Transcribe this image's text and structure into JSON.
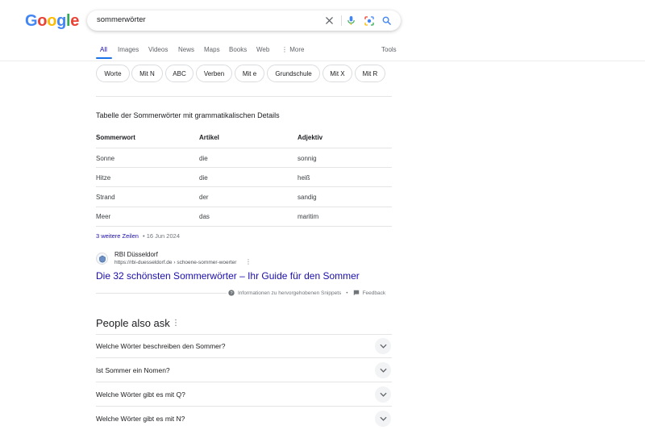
{
  "search": {
    "logo_text": "Google",
    "query": "sommerwörter"
  },
  "tabs": {
    "items": [
      "All",
      "Images",
      "Videos",
      "News",
      "Maps",
      "Books",
      "Web",
      "More"
    ],
    "tools": "Tools"
  },
  "chips": [
    "Worte",
    "Mit N",
    "ABC",
    "Verben",
    "Mit e",
    "Grundschule",
    "Mit X",
    "Mit R"
  ],
  "featured_snippet": {
    "caption": "Tabelle der Sommerwörter mit grammatikalischen Details",
    "columns": [
      "Sommerwort",
      "Artikel",
      "Adjektiv"
    ],
    "rows": [
      [
        "Sonne",
        "die",
        "sonnig"
      ],
      [
        "Hitze",
        "die",
        "heiß"
      ],
      [
        "Strand",
        "der",
        "sandig"
      ],
      [
        "Meer",
        "das",
        "maritim"
      ]
    ],
    "more_rows": "3 weitere Zeilen",
    "date": "• 16 Jun 2024",
    "site_name": "RBI Düsseldorf",
    "site_url": "https://rbi-duesseldorf.de › schoene-sommer-woerter",
    "result_title": "Die 32 schönsten Sommerwörter – Ihr Guide für den Sommer",
    "info_label": "Informationen zu hervorgehobenen Snippets",
    "feedback_label": "Feedback"
  },
  "people_also_ask": {
    "title": "People also ask",
    "questions": [
      "Welche Wörter beschreiben den Sommer?",
      "Ist Sommer ein Nomen?",
      "Welche Wörter gibt es mit Q?",
      "Welche Wörter gibt es mit N?"
    ]
  },
  "colors": {
    "link": "#1a0dab",
    "active_tab_underline": "#1a73e8",
    "google_blue": "#4285F4",
    "google_red": "#EA4335",
    "google_yellow": "#FBBC05",
    "google_green": "#34A853"
  }
}
